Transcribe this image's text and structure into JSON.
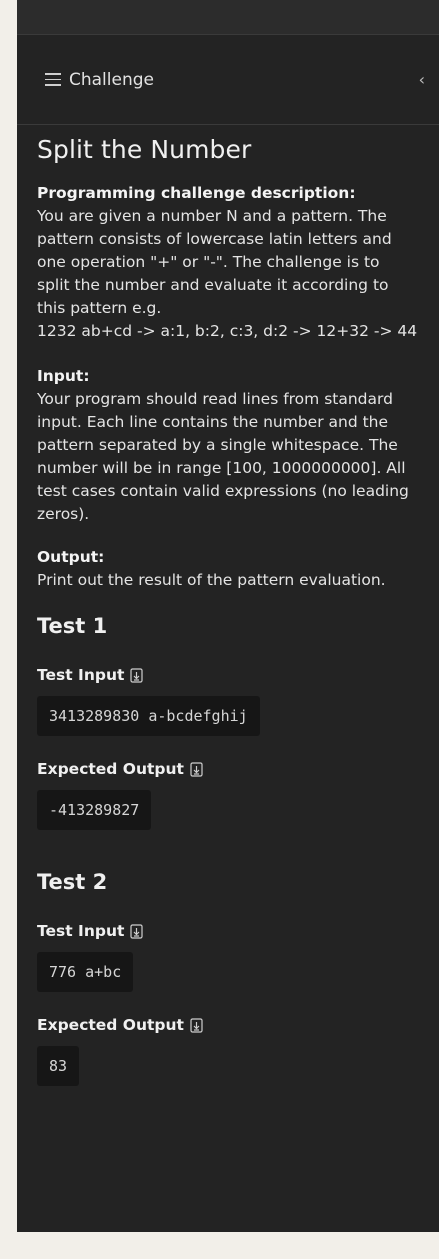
{
  "header": {
    "title": "Challenge",
    "collapse_label": "‹"
  },
  "challenge": {
    "title": "Split the Number",
    "description_label": "Programming challenge description:",
    "description_lines": [
      "You are given a number N and a pattern. The",
      "pattern consists of lowercase latin letters and",
      "one operation \"+\" or \"-\". The challenge is to",
      "split the number and evaluate it according to",
      "this pattern e.g.",
      "1232 ab+cd -> a:1, b:2, c:3, d:2 -> 12+32 -> 44"
    ],
    "input_label": "Input:",
    "input_lines": [
      "Your program should read lines from standard",
      "input. Each line contains the number and the",
      "pattern separated by a single whitespace. The",
      "number will be in range [100, 1000000000]. All",
      "test cases contain valid expressions (no leading",
      "zeros)."
    ],
    "output_label": "Output:",
    "output_lines": [
      "Print out the result of the pattern evaluation."
    ]
  },
  "tests": [
    {
      "title": "Test 1",
      "input_label": "Test Input",
      "input": "3413289830 a-bcdefghij",
      "output_label": "Expected Output",
      "output": "-413289827"
    },
    {
      "title": "Test 2",
      "input_label": "Test Input",
      "input": "776 a+bc",
      "output_label": "Expected Output",
      "output": "83"
    }
  ],
  "icons": {
    "menu": "list-icon",
    "download": "download-file-icon",
    "collapse": "chevron-left-icon"
  }
}
